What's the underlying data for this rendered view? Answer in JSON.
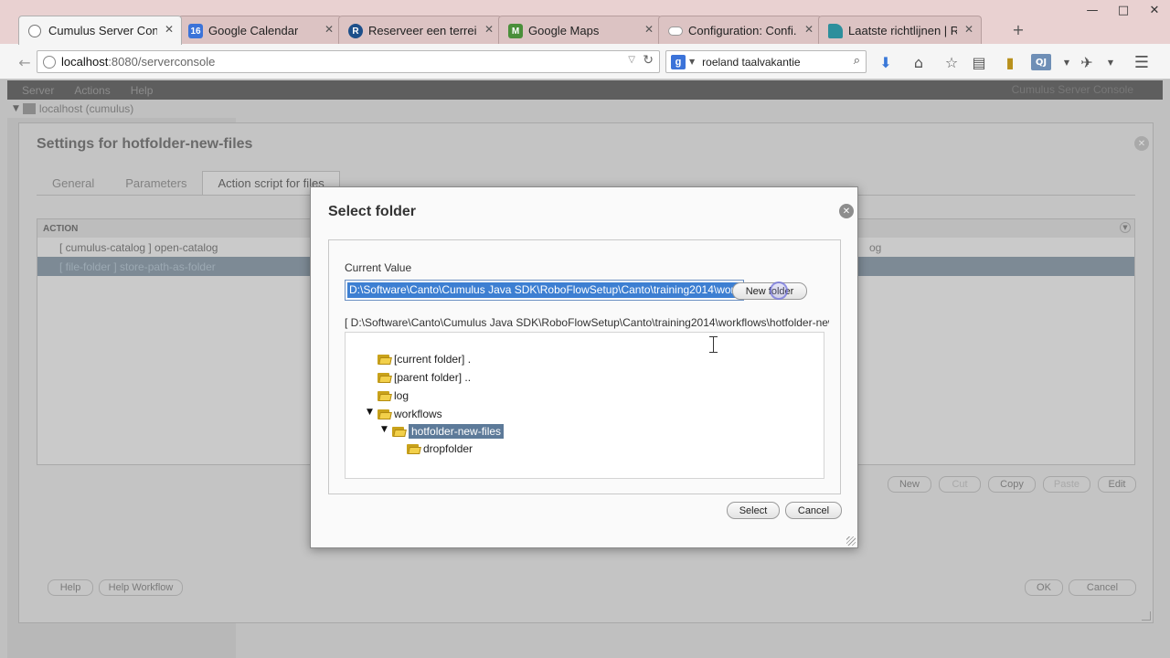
{
  "browser": {
    "tabs": [
      {
        "label": "Cumulus Server Conso",
        "icon": "page-icon",
        "color": "#ffffff",
        "active": true
      },
      {
        "label": "Google Calendar",
        "icon": "calendar-icon",
        "color": "#3b73d9",
        "badge": "16"
      },
      {
        "label": "Reserveer een terrein ...",
        "icon": "reservation-icon",
        "color": "#1d4f8a",
        "badge": "R"
      },
      {
        "label": "Google Maps",
        "icon": "maps-icon",
        "color": "#4a8f3a",
        "badge": "M"
      },
      {
        "label": "Configuration: Confi...",
        "icon": "cloud-icon",
        "color": "#ffffff"
      },
      {
        "label": "Laatste richtlijnen | R...",
        "icon": "bookmark-icon",
        "color": "#2d8f9c"
      }
    ],
    "url_host": "localhost",
    "url_rest": ":8080/serverconsole",
    "search_value": "roeland taalvakantie",
    "window_controls": {
      "minimize": "—",
      "maximize": "□",
      "close": "✕"
    }
  },
  "app": {
    "menu": [
      "Server",
      "Actions",
      "Help"
    ],
    "menu_right": "Cumulus Server Console",
    "tree_root": "localhost (cumulus)",
    "settings": {
      "title": "Settings for hotfolder-new-files",
      "tabs": [
        "General",
        "Parameters",
        "Action script for files"
      ],
      "active_tab": "Action script for files",
      "grid_header": "ACTION",
      "rows": [
        {
          "text": "[ cumulus-catalog ] open-catalog",
          "tail": "og"
        },
        {
          "text": "[ file-folder ] store-path-as-folder",
          "tail": ""
        }
      ],
      "grid_buttons": {
        "new": "New",
        "cut": "Cut",
        "copy": "Copy",
        "paste": "Paste",
        "edit": "Edit"
      },
      "footer_left": {
        "help": "Help",
        "help_workflow": "Help Workflow"
      },
      "footer_right": {
        "ok": "OK",
        "cancel": "Cancel"
      }
    }
  },
  "dialog": {
    "title": "Select folder",
    "current_value_label": "Current Value",
    "current_value": "D:\\Software\\Canto\\Cumulus Java SDK\\RoboFlowSetup\\Canto\\training2014\\workflows\\hotfolder-new-files",
    "new_folder_label": "New folder",
    "path_line": "[ D:\\Software\\Canto\\Cumulus Java SDK\\RoboFlowSetup\\Canto\\training2014\\workflows\\hotfolder-new-files ]",
    "tree": [
      {
        "label": "[current folder] .",
        "depth": 0
      },
      {
        "label": "[parent folder] ..",
        "depth": 0
      },
      {
        "label": "log",
        "depth": 0
      },
      {
        "label": "workflows",
        "depth": 0,
        "expanded": true
      },
      {
        "label": "hotfolder-new-files",
        "depth": 1,
        "expanded": true,
        "selected": true
      },
      {
        "label": "dropfolder",
        "depth": 2
      }
    ],
    "select_label": "Select",
    "cancel_label": "Cancel",
    "close_glyph": "✕"
  }
}
